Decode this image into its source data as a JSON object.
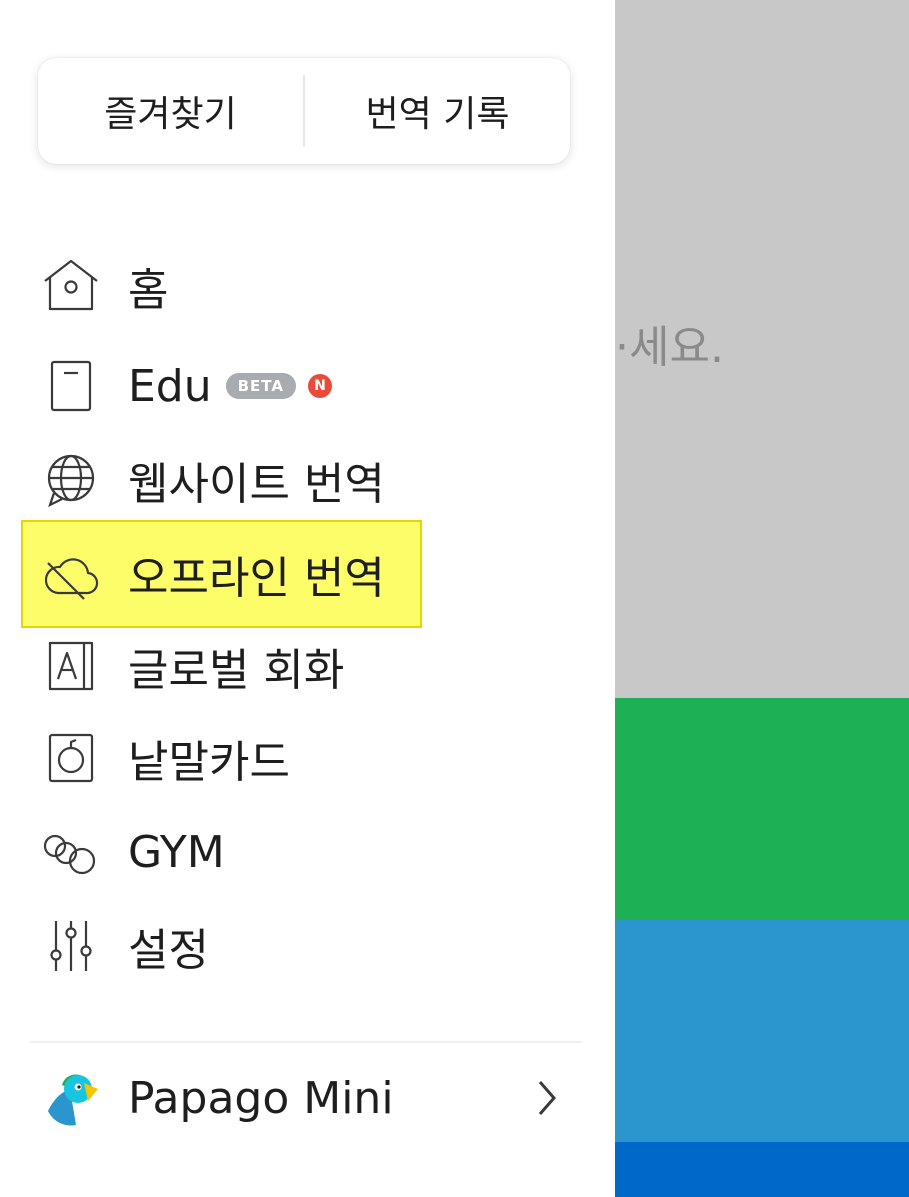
{
  "background": {
    "partial_text": "·세요.",
    "colors": {
      "gray": "#c8c8c8",
      "green": "#1db054",
      "blue": "#2b95cd",
      "dark_blue": "#0068c9"
    }
  },
  "drawer": {
    "tabs": [
      {
        "label": "즐겨찾기"
      },
      {
        "label": "번역 기록"
      }
    ],
    "menu": [
      {
        "label": "홈",
        "icon": "home-icon"
      },
      {
        "label": "Edu",
        "icon": "book-icon",
        "badge": "BETA",
        "new_badge": "N"
      },
      {
        "label": "웹사이트 번역",
        "icon": "globe-icon"
      },
      {
        "label": "오프라인 번역",
        "icon": "cloud-off-icon",
        "highlighted": true
      },
      {
        "label": "글로벌 회화",
        "icon": "phrasebook-icon"
      },
      {
        "label": "낱말카드",
        "icon": "flashcard-icon"
      },
      {
        "label": "GYM",
        "icon": "gym-icon"
      },
      {
        "label": "설정",
        "icon": "settings-sliders-icon"
      }
    ],
    "footer": {
      "label": "Papago Mini",
      "icon": "papago-logo-icon",
      "chevron": "chevron-right-icon"
    }
  },
  "colors": {
    "highlight": "#fdfd6a",
    "highlight_border": "#e9d400",
    "text": "#1e1e1e",
    "icon": "#3a3a3a",
    "new_badge": "#e94a3a",
    "beta_badge": "#a8abb0"
  }
}
